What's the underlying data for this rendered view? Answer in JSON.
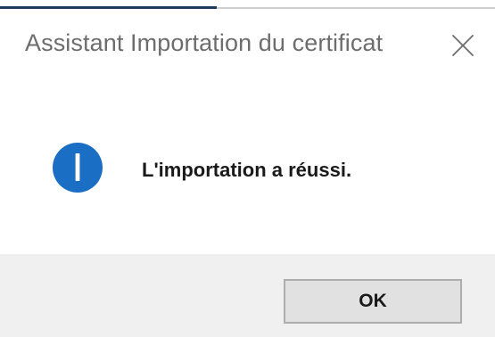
{
  "dialog": {
    "title": "Assistant Importation du certificat",
    "close_icon": "close-icon",
    "message_icon": "info-icon",
    "message": "L'importation a réussi.",
    "ok_label": "OK"
  },
  "colors": {
    "title_text": "#6d6d6d",
    "info_icon": "#1a6fc4",
    "footer_background": "#f0f0f0",
    "button_background": "#e1e1e1",
    "button_border": "#adadad",
    "window_accent": "#1f3b5a"
  }
}
